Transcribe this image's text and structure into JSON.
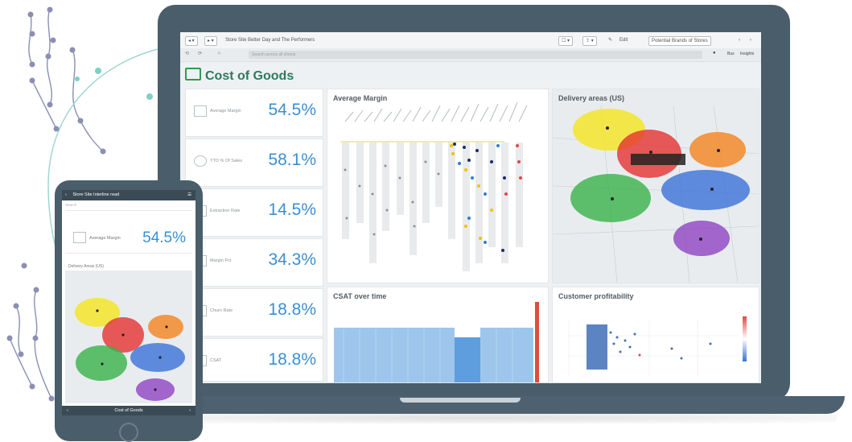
{
  "app": {
    "tab_title": "Store Site Better Day and The Performers",
    "toolbar_items": [
      "Edit",
      "Potential Brands of Stores",
      "Bus",
      "Insights"
    ],
    "address_placeholder": "Search across all sheets"
  },
  "sheet": {
    "title": "Cost of Goods"
  },
  "kpis": [
    {
      "label": "Average Margin",
      "value": "54.5%",
      "icon": "table-icon"
    },
    {
      "label": "YTD % Of Sales",
      "value": "58.1%",
      "icon": "gauge-icon"
    },
    {
      "label": "Extraction Rate",
      "value": "14.5%",
      "icon": "table-icon"
    },
    {
      "label": "Margin Pct",
      "value": "34.3%",
      "icon": "table-icon"
    },
    {
      "label": "Churn Rate",
      "value": "18.8%",
      "icon": "table-icon"
    },
    {
      "label": "CSAT",
      "value": "18.8%",
      "icon": "table-icon"
    }
  ],
  "panels": {
    "average_margin": {
      "title": "Average Margin"
    },
    "delivery_areas": {
      "title": "Delivery areas (US)"
    },
    "csat": {
      "title": "CSAT over time"
    },
    "profitability": {
      "title": "Customer profitability"
    }
  },
  "mobile": {
    "header_title": "Store Site Interline read",
    "search_placeholder": "Search",
    "kpi": {
      "label": "Average Margin",
      "value": "54.5%"
    },
    "map_title": "Delivery Areas (US)",
    "footer": "Cost of Goods"
  },
  "colors": {
    "accent": "#3b8fd4",
    "brand_green": "#2f7a5e",
    "device_frame": "#4a5d6a"
  }
}
